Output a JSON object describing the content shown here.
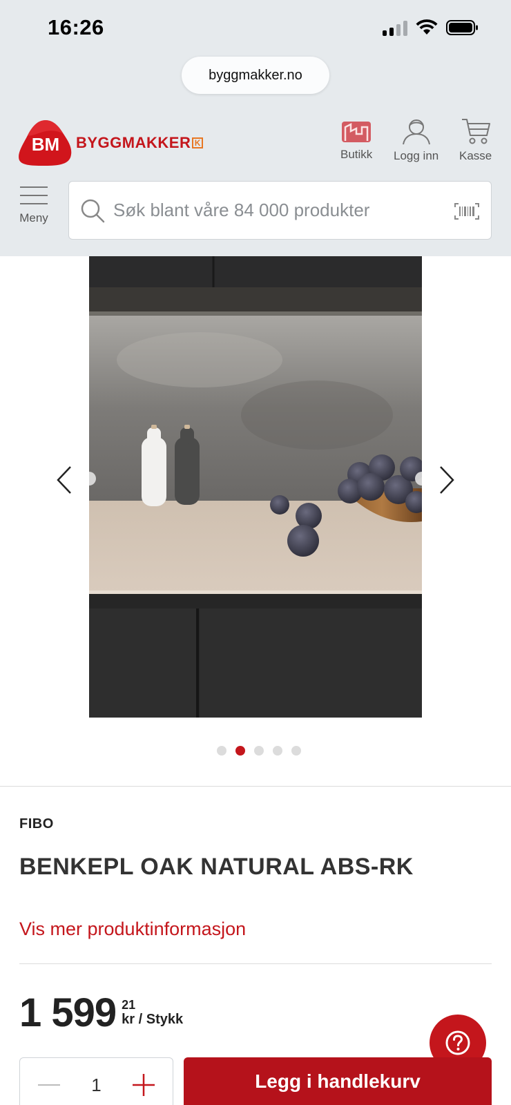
{
  "status_bar": {
    "time": "16:26"
  },
  "browser": {
    "url": "byggmakker.no"
  },
  "header": {
    "logo_badge": "BM",
    "logo_text": "BYGGMAKKER",
    "logo_k": "K",
    "butikk_label": "Butikk",
    "login_label": "Logg inn",
    "cart_label": "Kasse",
    "menu_label": "Meny",
    "search_placeholder": "Søk blant våre 84 000 produkter"
  },
  "gallery": {
    "image_count": 5,
    "active_index": 1
  },
  "product": {
    "brand": "FIBO",
    "title": "BENKEPL OAK NATURAL ABS-RK",
    "more_info_link": "Vis mer produktinformasjon",
    "price_main": "1 599",
    "price_decimals": "21",
    "price_unit": "kr / Stykk",
    "quantity": "1",
    "add_to_cart_label": "Legg i handlekurv"
  },
  "colors": {
    "brand_red": "#c4161c",
    "button_red": "#b5121b",
    "header_bg": "#e6eaed"
  }
}
